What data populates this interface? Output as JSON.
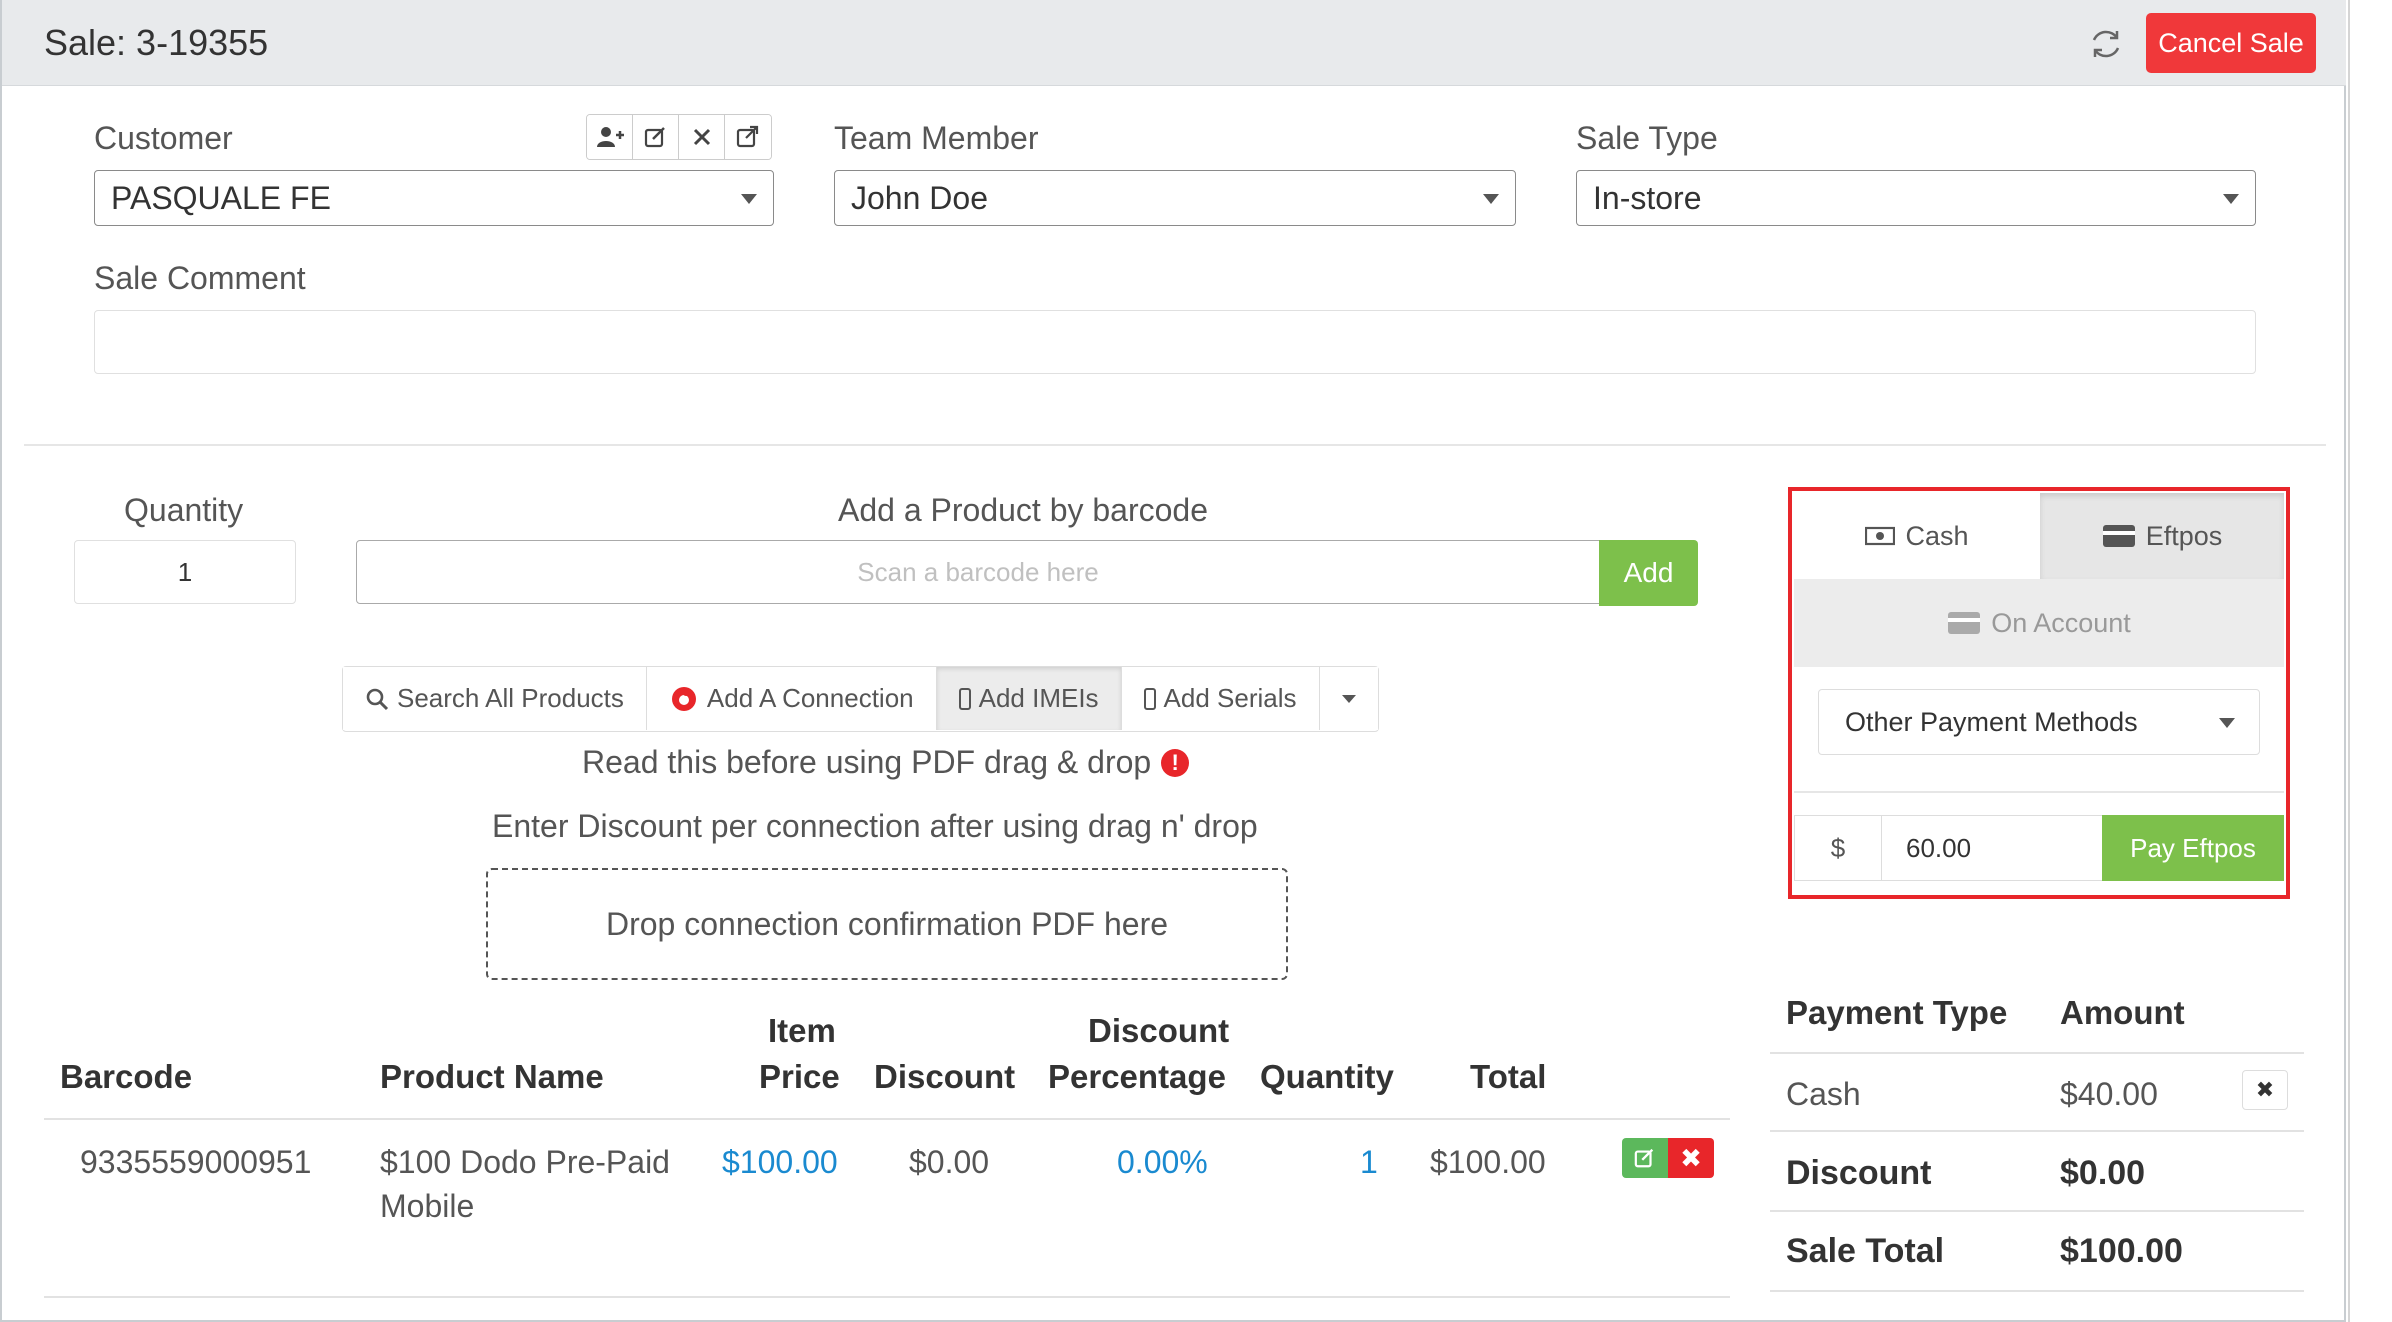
{
  "header": {
    "title": "Sale: 3-19355",
    "cancel_label": "Cancel Sale"
  },
  "form": {
    "customer_label": "Customer",
    "customer_value": "PASQUALE FE",
    "team_label": "Team Member",
    "team_value": "John Doe",
    "sale_type_label": "Sale Type",
    "sale_type_value": "In-store",
    "comment_label": "Sale Comment",
    "comment_value": ""
  },
  "entry": {
    "quantity_label": "Quantity",
    "quantity_value": "1",
    "barcode_label": "Add a Product by barcode",
    "barcode_placeholder": "Scan a barcode here",
    "add_label": "Add"
  },
  "toolbar": {
    "search": "Search All Products",
    "connection": "Add A Connection",
    "imeis": "Add IMEIs",
    "serials": "Add Serials"
  },
  "notes": {
    "read": "Read this before using PDF drag & drop",
    "discount": "Enter Discount per connection after using drag n' drop",
    "dropzone": "Drop connection confirmation PDF here"
  },
  "table": {
    "headers": {
      "barcode": "Barcode",
      "product": "Product Name",
      "item_price_1": "Item",
      "item_price_2": "Price",
      "discount": "Discount",
      "disc_pct_1": "Discount",
      "disc_pct_2": "Percentage",
      "quantity": "Quantity",
      "total": "Total"
    },
    "rows": [
      {
        "barcode": "9335559000951",
        "product_1": "$100 Dodo Pre-Paid",
        "product_2": "Mobile",
        "price": "$100.00",
        "discount": "$0.00",
        "disc_pct": "0.00%",
        "quantity": "1",
        "total": "$100.00"
      }
    ]
  },
  "payment": {
    "tab_cash": "Cash",
    "tab_eftpos": "Eftpos",
    "tab_account": "On Account",
    "method_select": "Other Payment Methods",
    "currency": "$",
    "amount": "60.00",
    "pay_button": "Pay Eftpos"
  },
  "summary": {
    "col_type": "Payment Type",
    "col_amount": "Amount",
    "payments": [
      {
        "type": "Cash",
        "amount": "$40.00"
      }
    ],
    "discount_label": "Discount",
    "discount_value": "$0.00",
    "total_label": "Sale Total",
    "total_value": "$100.00"
  },
  "colors": {
    "accent_red": "#f0383a",
    "green": "#7dc04b",
    "link_blue": "#1a8ad0",
    "highlight_border": "#e8262a"
  }
}
